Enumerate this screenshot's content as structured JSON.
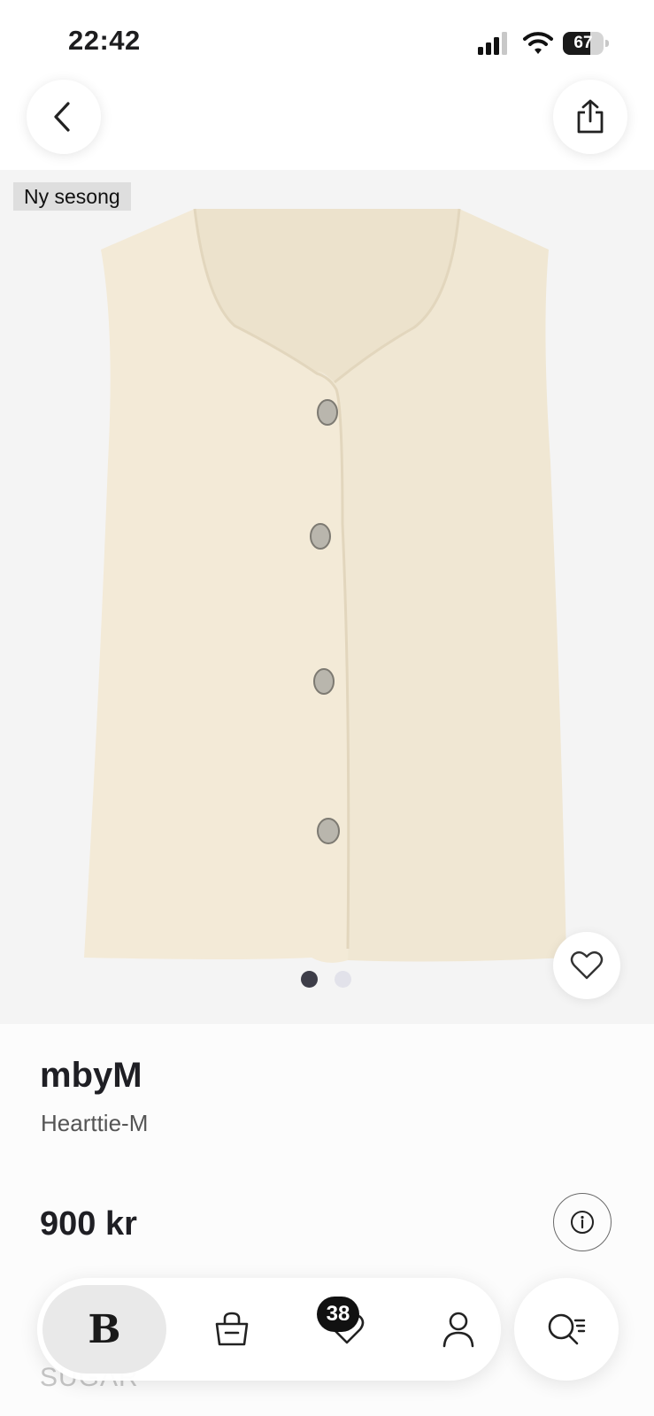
{
  "status": {
    "time": "22:42",
    "battery": "67",
    "battery_level": 0.67
  },
  "product": {
    "badge": "Ny sesong",
    "brand": "mbyM",
    "name": "Hearttie-M",
    "price": "900 kr",
    "image_count": 2,
    "active_image": 0
  },
  "below_fold_text": "SUGAR",
  "nav": {
    "home_label": "B",
    "favorites_count": "38"
  },
  "colors": {
    "vest": "#f3ead7",
    "gallery_bg": "#f4f4f4",
    "active_dot": "#3d3d48",
    "inactive_dot": "#e2e2ea"
  },
  "icons": {
    "back": "chevron-left-icon",
    "share": "share-icon",
    "favorite": "heart-icon",
    "info": "info-icon",
    "bag": "shopping-bag-icon",
    "nav_favorites": "heart-icon",
    "profile": "person-icon",
    "search": "search-icon"
  }
}
